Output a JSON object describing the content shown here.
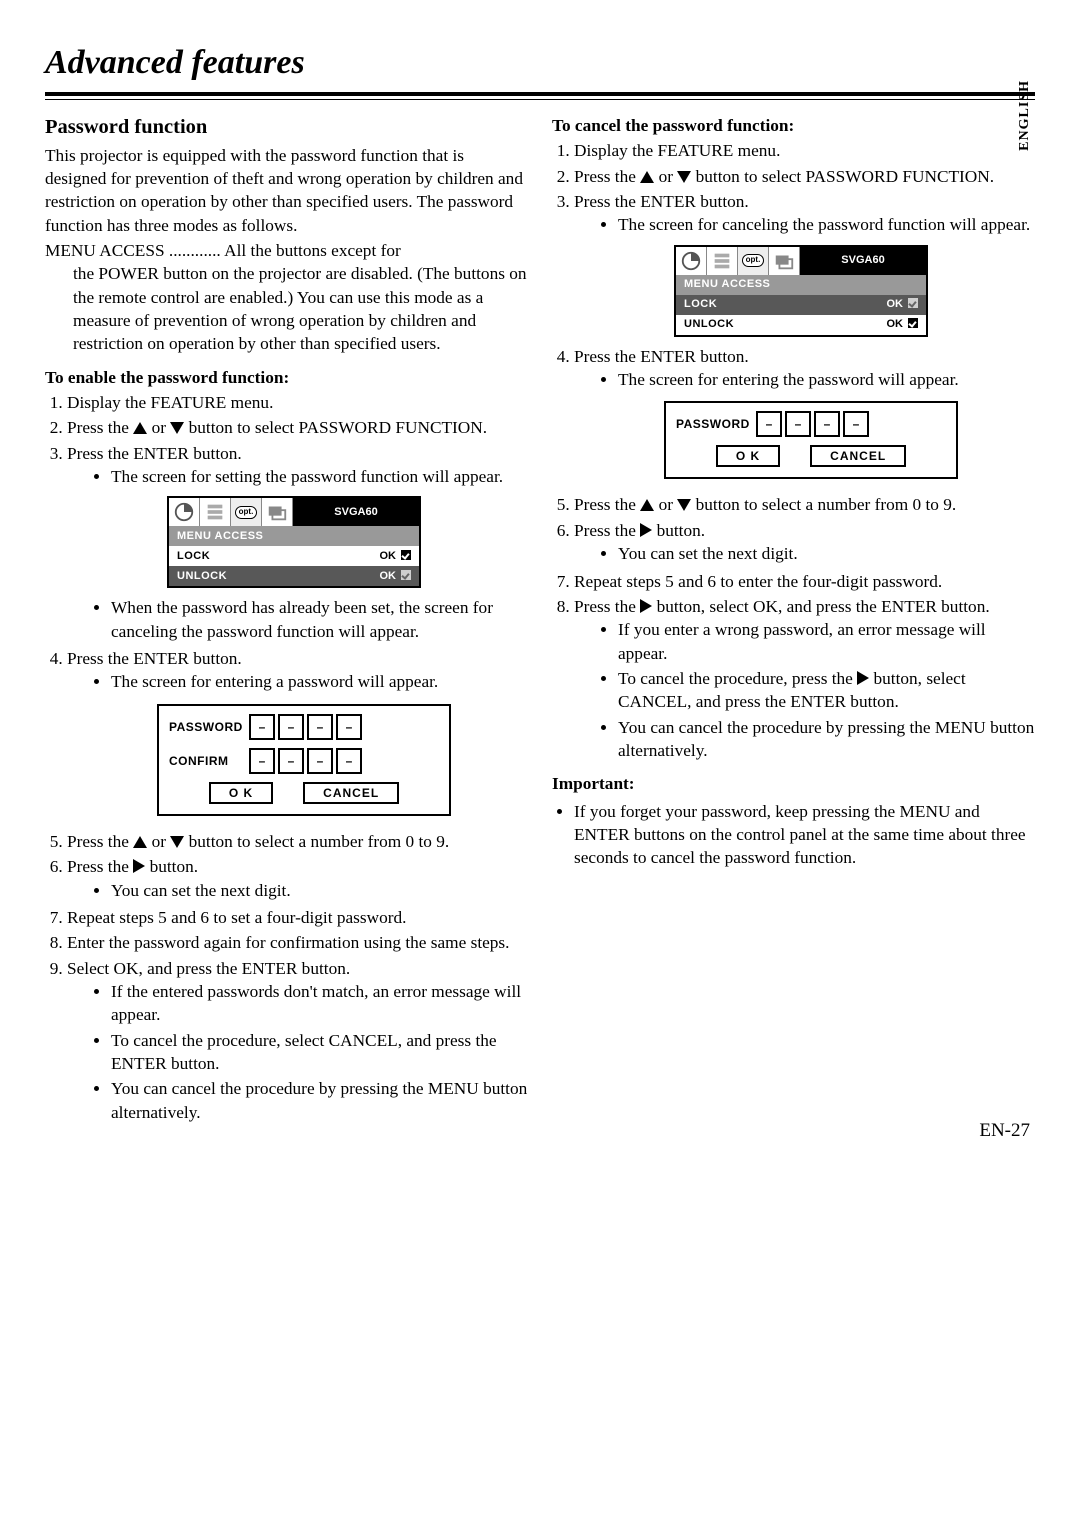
{
  "page_title": "Advanced features",
  "language_label": "ENGLISH",
  "page_number": "EN-27",
  "left": {
    "section_heading": "Password function",
    "intro": "This projector is equipped with the password function that is designed for prevention of theft and wrong operation by children and restriction on operation by other than specified users. The password function has three modes as follows.",
    "menu_access_term": "MENU ACCESS ............",
    "menu_access_body": "All the buttons except for the POWER button on the projector are disabled. (The buttons on the remote control are enabled.) You can use this mode as a measure of prevention of wrong operation by children and restriction on operation by other than specified users.",
    "enable_heading": "To enable the password function:",
    "step1": "Display the FEATURE menu.",
    "step2_pre": "Press the ",
    "step2_mid": " or ",
    "step2_post": " button to select PASSWORD FUNCTION.",
    "step3": "Press the ENTER button.",
    "step3_b1": "The screen for setting the password function will appear.",
    "after_screen_b1": "When the password has already been set, the screen for canceling the password function will appear.",
    "step4": "Press the ENTER button.",
    "step4_b1": "The screen for entering a password will appear.",
    "step5_pre": "Press the ",
    "step5_mid": " or ",
    "step5_post": " button to select a number from 0 to 9.",
    "step6_pre": "Press the ",
    "step6_post": " button.",
    "step6_b1": "You can set the next digit.",
    "step7": "Repeat steps 5 and 6 to set a four-digit password.",
    "step8": "Enter the password again for confirmation using the same steps.",
    "step9": "Select OK, and press the ENTER button.",
    "step9_b1": "If the entered passwords don't match, an error message will appear.",
    "step9_b2": "To cancel the procedure, select CANCEL, and press the ENTER button.",
    "step9_b3": "You can cancel the procedure by pressing the MENU button alternatively."
  },
  "right": {
    "cancel_heading": "To cancel the password function:",
    "step1": "Display the FEATURE menu.",
    "step2_pre": "Press the ",
    "step2_mid": " or ",
    "step2_post": " button to select PASSWORD FUNCTION.",
    "step3": "Press the ENTER button.",
    "step3_b1": "The screen for canceling the password function will appear.",
    "step4": "Press the ENTER button.",
    "step4_b1": "The screen for entering the password will appear.",
    "step5_pre": "Press the ",
    "step5_mid": " or ",
    "step5_post": " button to select a number from 0 to 9.",
    "step6_pre": "Press the ",
    "step6_post": " button.",
    "step6_b1": "You can set the next digit.",
    "step7": "Repeat steps 5 and 6 to enter the four-digit password.",
    "step8_pre": "Press the ",
    "step8_post": " button, select OK, and press the ENTER button.",
    "step8_b1": "If you enter a wrong password, an error message will appear.",
    "step8_b2_pre": "To cancel the procedure, press the ",
    "step8_b2_post": " button, select CANCEL, and press the ENTER button.",
    "step8_b3": "You can cancel the procedure by pressing the MENU button alternatively.",
    "important_heading": "Important:",
    "important_b1": "If you forget your password, keep pressing the MENU and ENTER buttons on the control panel at the same time about three seconds to cancel the password function."
  },
  "menu_screen": {
    "badge": "SVGA60",
    "header": "MENU ACCESS",
    "lock": "LOCK",
    "unlock": "UNLOCK",
    "ok": "OK",
    "opt": "opt."
  },
  "pw_box": {
    "password": "PASSWORD",
    "confirm": "CONFIRM",
    "ok": "O K",
    "cancel": "CANCEL",
    "dash": "–"
  }
}
